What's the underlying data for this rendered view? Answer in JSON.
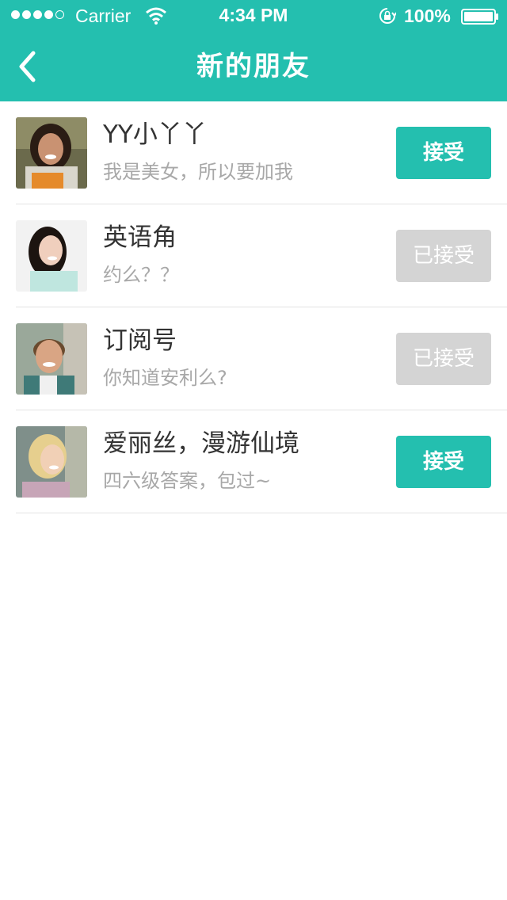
{
  "status_bar": {
    "carrier": "Carrier",
    "time": "4:34 PM",
    "battery": "100%",
    "signal_bars": 4,
    "icons": [
      "signal-icon",
      "wifi-icon",
      "rotation-lock-icon",
      "battery-icon"
    ]
  },
  "nav": {
    "title": "新的朋友",
    "back_icon": "chevron-left-icon"
  },
  "colors": {
    "accent": "#24bfaf",
    "accepted_button": "#d4d4d4",
    "name_text": "#333333",
    "message_text": "#a8a8a8"
  },
  "friends": [
    {
      "name": "YY小丫丫",
      "message": "我是美女，所以要加我",
      "button": "接受",
      "state": "accept",
      "avatar": "avatar-woman-student"
    },
    {
      "name": "英语角",
      "message": "约么？？",
      "button": "已接受",
      "state": "accepted",
      "avatar": "avatar-woman-portrait"
    },
    {
      "name": "订阅号",
      "message": "你知道安利么?",
      "button": "已接受",
      "state": "accepted",
      "avatar": "avatar-man-smiling"
    },
    {
      "name": "爱丽丝，漫游仙境",
      "message": "四六级答案，包过~",
      "button": "接受",
      "state": "accept",
      "avatar": "avatar-blonde-woman"
    }
  ]
}
